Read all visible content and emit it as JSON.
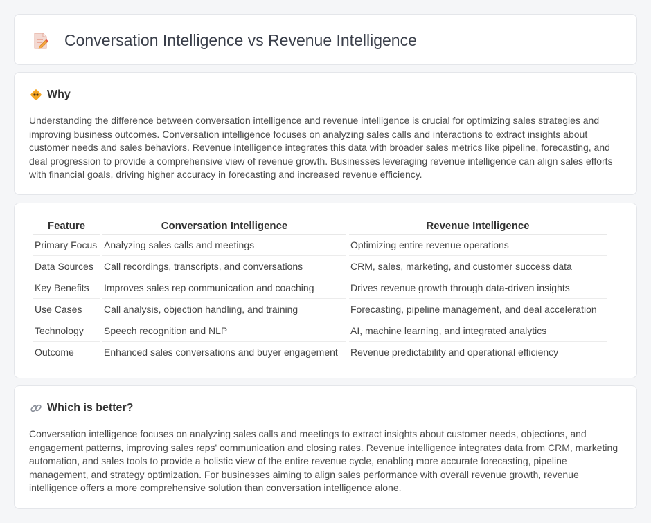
{
  "header": {
    "title": "Conversation Intelligence vs Revenue Intelligence",
    "icon": "document-pencil-icon"
  },
  "why": {
    "title": "Why",
    "icon": "diamond-sign-icon",
    "text": "Understanding the difference between conversation intelligence and revenue intelligence is crucial for optimizing sales strategies and improving business outcomes. Conversation intelligence focuses on analyzing sales calls and interactions to extract insights about customer needs and sales behaviors. Revenue intelligence integrates this data with broader sales metrics like pipeline, forecasting, and deal progression to provide a comprehensive view of revenue growth. Businesses leveraging revenue intelligence can align sales efforts with financial goals, driving higher accuracy in forecasting and increased revenue efficiency."
  },
  "comparison": {
    "headers": [
      "Feature",
      "Conversation Intelligence",
      "Revenue Intelligence"
    ],
    "rows": [
      [
        "Primary Focus",
        "Analyzing sales calls and meetings",
        "Optimizing entire revenue operations"
      ],
      [
        "Data Sources",
        "Call recordings, transcripts, and conversations",
        "CRM, sales, marketing, and customer success data"
      ],
      [
        "Key Benefits",
        "Improves sales rep communication and coaching",
        "Drives revenue growth through data-driven insights"
      ],
      [
        "Use Cases",
        "Call analysis, objection handling, and training",
        "Forecasting, pipeline management, and deal acceleration"
      ],
      [
        "Technology",
        "Speech recognition and NLP",
        "AI, machine learning, and integrated analytics"
      ],
      [
        "Outcome",
        "Enhanced sales conversations and buyer engagement",
        "Revenue predictability and operational efficiency"
      ]
    ]
  },
  "better": {
    "title": "Which is better?",
    "icon": "link-icon",
    "text": "Conversation intelligence focuses on analyzing sales calls and meetings to extract insights about customer needs, objections, and engagement patterns, improving sales reps' communication and closing rates. Revenue intelligence integrates data from CRM, marketing automation, and sales tools to provide a holistic view of the entire revenue cycle, enabling more accurate forecasting, pipeline management, and strategy optimization. For businesses aiming to align sales performance with overall revenue growth, revenue intelligence offers a more comprehensive solution than conversation intelligence alone."
  }
}
